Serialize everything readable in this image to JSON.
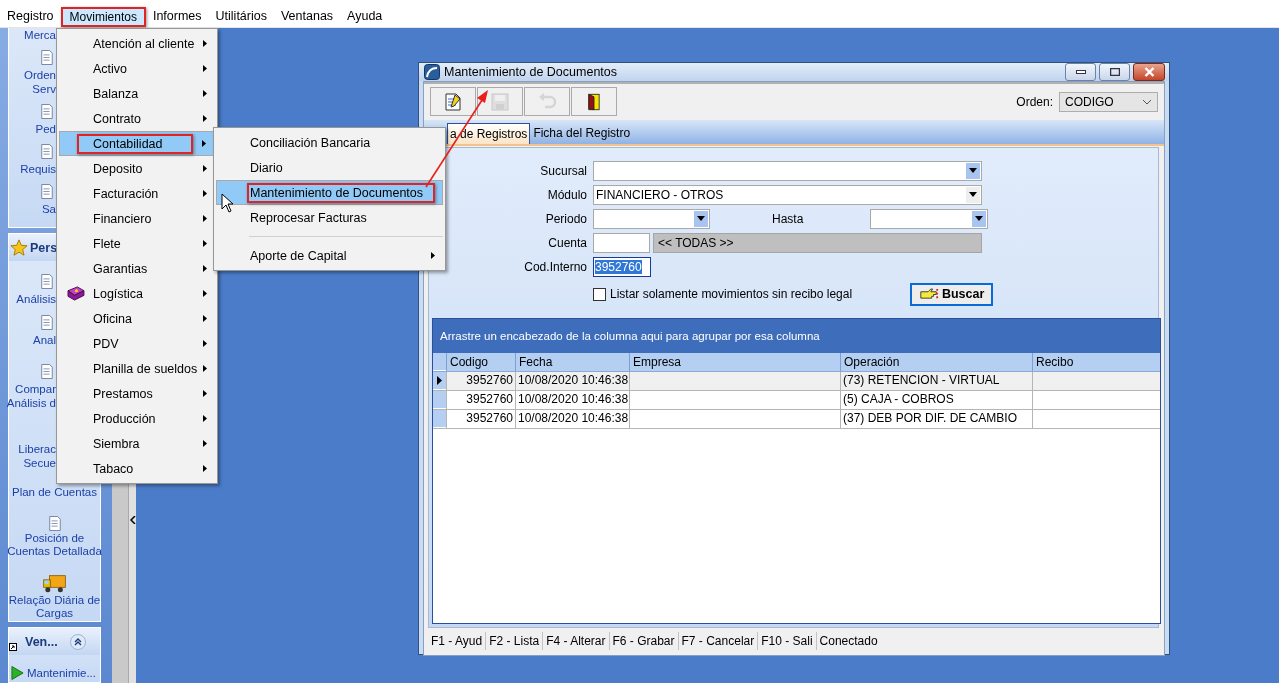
{
  "menubar": [
    {
      "label": "Registro",
      "selected": false,
      "annotated": false
    },
    {
      "label": "Movimientos",
      "selected": true,
      "annotated": true
    },
    {
      "label": "Informes",
      "selected": false,
      "annotated": false
    },
    {
      "label": "Utilitários",
      "selected": false,
      "annotated": false
    },
    {
      "label": "Ventanas",
      "selected": false,
      "annotated": false
    },
    {
      "label": "Ayuda",
      "selected": false,
      "annotated": false
    }
  ],
  "sidebar": {
    "panels": [
      {
        "items": [
          {
            "kind": "partial",
            "lines": [
              "Merca"
            ]
          },
          {
            "kind": "partial",
            "lines": [
              "Orden",
              "Serv"
            ]
          },
          {
            "kind": "partial",
            "lines": [
              "Ped"
            ]
          },
          {
            "kind": "partial",
            "lines": [
              "Requis"
            ]
          },
          {
            "kind": "partial",
            "lines": [
              "Sa"
            ]
          }
        ]
      },
      {
        "title": "Pers",
        "items": [
          {
            "kind": "partial",
            "lines": [
              "Análisis"
            ]
          },
          {
            "kind": "partial",
            "lines": [
              "Anal"
            ]
          },
          {
            "kind": "partial",
            "lines": [
              "Compar",
              "Análisis d"
            ]
          },
          {
            "kind": "partial",
            "lines": [
              "Liberac",
              "Secue"
            ]
          },
          {
            "kind": "whole",
            "lines": [
              "Plan de Cuentas"
            ]
          },
          {
            "kind": "whole",
            "lines": [
              "Posición de",
              "Cuentas Detallada"
            ]
          },
          {
            "kind": "whole",
            "lines": [
              "Relação Diária de",
              "Cargas"
            ]
          }
        ]
      },
      {
        "title": "Ven...",
        "items": [
          {
            "kind": "whole",
            "lines": [
              "Mantenimie..."
            ]
          }
        ]
      }
    ]
  },
  "menu": {
    "items": [
      {
        "kind": "plain",
        "label": "Atención al cliente",
        "selected": false,
        "annotated": false,
        "submenu": true
      },
      {
        "kind": "plain",
        "label": "Activo",
        "selected": false,
        "annotated": false,
        "submenu": true
      },
      {
        "kind": "plain",
        "label": "Balanza",
        "selected": false,
        "annotated": false,
        "submenu": true
      },
      {
        "kind": "plain",
        "label": "Contrato",
        "selected": false,
        "annotated": false,
        "submenu": true
      },
      {
        "kind": "plain",
        "label": "Contabilidad",
        "selected": true,
        "annotated": true,
        "submenu": true
      },
      {
        "kind": "plain",
        "label": "Deposito",
        "selected": false,
        "annotated": false,
        "submenu": true
      },
      {
        "kind": "plain",
        "label": "Facturación",
        "selected": false,
        "annotated": false,
        "submenu": true
      },
      {
        "kind": "plain",
        "label": "Financiero",
        "selected": false,
        "annotated": false,
        "submenu": true
      },
      {
        "kind": "plain",
        "label": "Flete",
        "selected": false,
        "annotated": false,
        "submenu": true
      },
      {
        "kind": "plain",
        "label": "Garantias",
        "selected": false,
        "annotated": false,
        "submenu": true
      },
      {
        "kind": "with-icon",
        "label": "Logística",
        "selected": false,
        "annotated": false,
        "submenu": true
      },
      {
        "kind": "plain",
        "label": "Oficina",
        "selected": false,
        "annotated": false,
        "submenu": true
      },
      {
        "kind": "plain",
        "label": "PDV",
        "selected": false,
        "annotated": false,
        "submenu": true
      },
      {
        "kind": "plain",
        "label": "Planilla de sueldos",
        "selected": false,
        "annotated": false,
        "submenu": true
      },
      {
        "kind": "plain",
        "label": "Prestamos",
        "selected": false,
        "annotated": false,
        "submenu": true
      },
      {
        "kind": "plain",
        "label": "Producción",
        "selected": false,
        "annotated": false,
        "submenu": true
      },
      {
        "kind": "plain",
        "label": "Siembra",
        "selected": false,
        "annotated": false,
        "submenu": true
      },
      {
        "kind": "plain",
        "label": "Tabaco",
        "selected": false,
        "annotated": false,
        "submenu": true
      }
    ]
  },
  "submenu": {
    "items": [
      {
        "kind": "item",
        "label": "Conciliación Bancaria",
        "selected": false,
        "annotated": false,
        "submenu": false
      },
      {
        "kind": "item",
        "label": "Diario",
        "selected": false,
        "annotated": false,
        "submenu": false
      },
      {
        "kind": "item",
        "label": "Mantenimiento de Documentos",
        "selected": true,
        "annotated": true,
        "submenu": false
      },
      {
        "kind": "item",
        "label": "Reprocesar Facturas",
        "selected": false,
        "annotated": false,
        "submenu": false
      },
      {
        "kind": "separator"
      },
      {
        "kind": "item",
        "label": "Aporte de Capital",
        "selected": false,
        "annotated": false,
        "submenu": true
      }
    ]
  },
  "window": {
    "title": "Mantenimiento de Documentos",
    "toolbar": [
      {
        "disabled": false
      },
      {
        "disabled": true
      },
      {
        "disabled": true
      },
      {
        "disabled": false
      }
    ],
    "order": {
      "label": "Orden:",
      "value": "CODIGO"
    },
    "tabs": [
      {
        "label": "a de Registros",
        "selected": true
      },
      {
        "label": "Ficha del Registro",
        "selected": false
      }
    ],
    "form": {
      "sucursal": {
        "label": "Sucursal"
      },
      "modulo": {
        "label": "Módulo",
        "value": "FINANCIERO - OTROS"
      },
      "periodo": {
        "label": "Periodo"
      },
      "hasta": {
        "label": "Hasta"
      },
      "cuenta": {
        "label": "Cuenta",
        "description": "<< TODAS >>"
      },
      "cod_interno": {
        "label": "Cod.Interno",
        "value": "3952760",
        "text_selected": true
      },
      "only_without_receipt": {
        "label": "Listar solamente movimientos sin recibo legal",
        "checked": false
      },
      "search_button": "Buscar"
    },
    "grid": {
      "group_hint": "Arrastre un encabezado de la columna aqui para agrupar por esa columna",
      "columns": [
        "Codigo",
        "Fecha",
        "Empresa",
        "Operación",
        "Recibo"
      ],
      "rows": [
        {
          "codigo": "3952760",
          "fecha": "10/08/2020 10:46:38",
          "operacion": "(73) RETENCION - VIRTUAL",
          "selected": true
        },
        {
          "codigo": "3952760",
          "fecha": "10/08/2020 10:46:38",
          "operacion": "(5) CAJA - COBROS",
          "selected": false
        },
        {
          "codigo": "3952760",
          "fecha": "10/08/2020 10:46:38",
          "operacion": "(37) DEB POR DIF. DE CAMBIO",
          "selected": false
        }
      ]
    },
    "status_bar": [
      "F1 - Ayud",
      "F2 - Lista",
      "F4 - Alterar",
      "F6 - Grabar",
      "F7 - Cancelar",
      "F10 - Sali",
      "Conectado"
    ]
  }
}
